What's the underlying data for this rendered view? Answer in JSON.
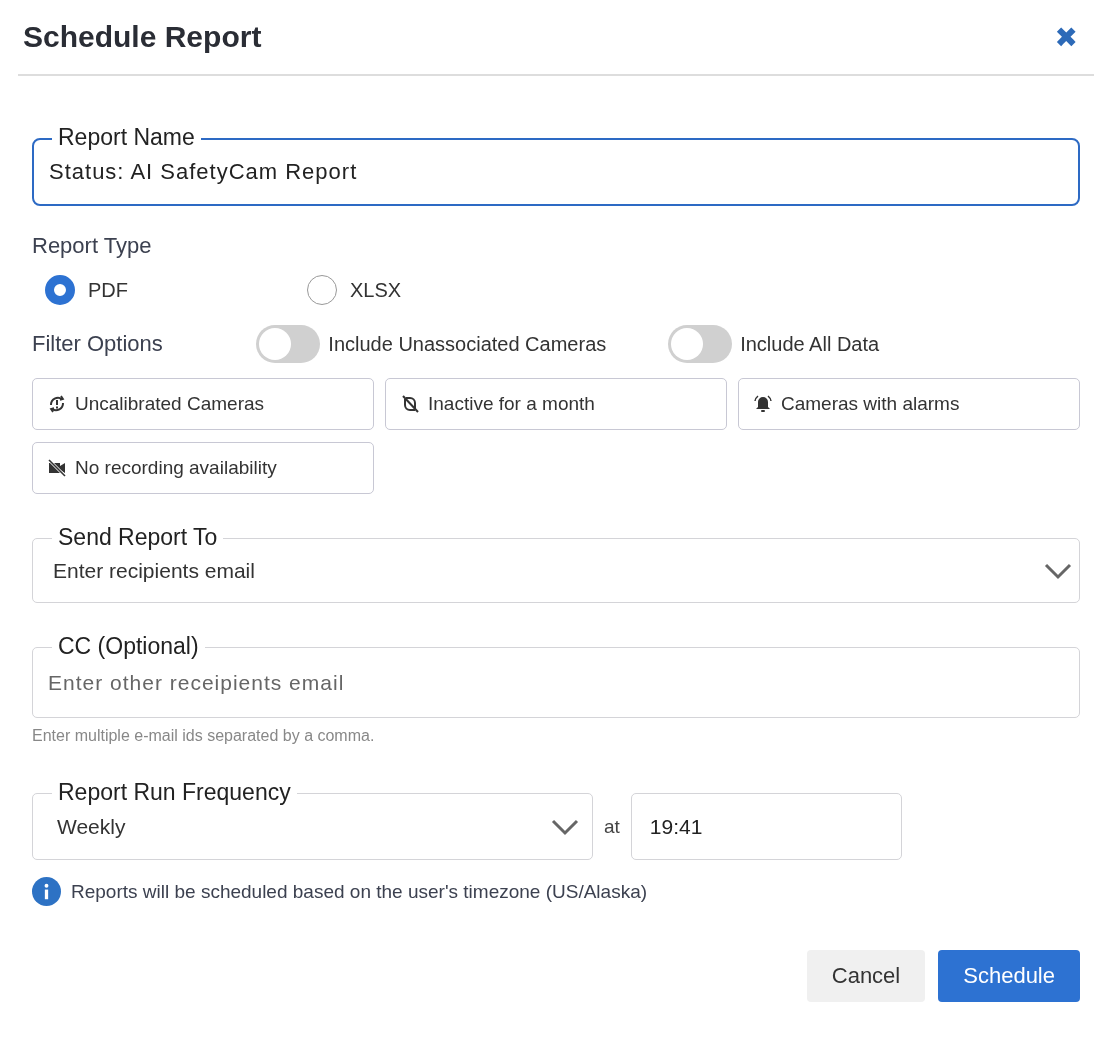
{
  "dialog": {
    "title": "Schedule Report",
    "close": "✖"
  },
  "report_name": {
    "label": "Report Name",
    "value": "Status: AI SafetyCam Report",
    "focused": true
  },
  "report_type": {
    "label": "Report Type",
    "options": [
      {
        "label": "PDF",
        "selected": true
      },
      {
        "label": "XLSX",
        "selected": false
      }
    ]
  },
  "filter_options": {
    "label": "Filter Options",
    "toggles": [
      {
        "label": "Include Unassociated Cameras",
        "on": false
      },
      {
        "label": "Include All Data",
        "on": false
      }
    ],
    "chips": [
      {
        "label": "Uncalibrated Cameras",
        "selected": false
      },
      {
        "label": "Inactive for a month",
        "selected": false
      },
      {
        "label": "Cameras with alarms",
        "selected": false
      },
      {
        "label": "No recording availability",
        "selected": false
      }
    ]
  },
  "send_to": {
    "label": "Send Report To",
    "placeholder": "Enter recipients email"
  },
  "cc": {
    "label": "CC (Optional)",
    "placeholder": "Enter other receipients email",
    "hint": "Enter multiple e-mail ids separated by a comma."
  },
  "frequency": {
    "label": "Report Run Frequency",
    "value": "Weekly",
    "at": "at",
    "time": "19:41"
  },
  "note": "Reports will be scheduled based on the user's timezone (US/Alaska)",
  "buttons": [
    {
      "label": "Cancel",
      "kind": "secondary"
    },
    {
      "label": "Schedule",
      "kind": "primary"
    }
  ]
}
